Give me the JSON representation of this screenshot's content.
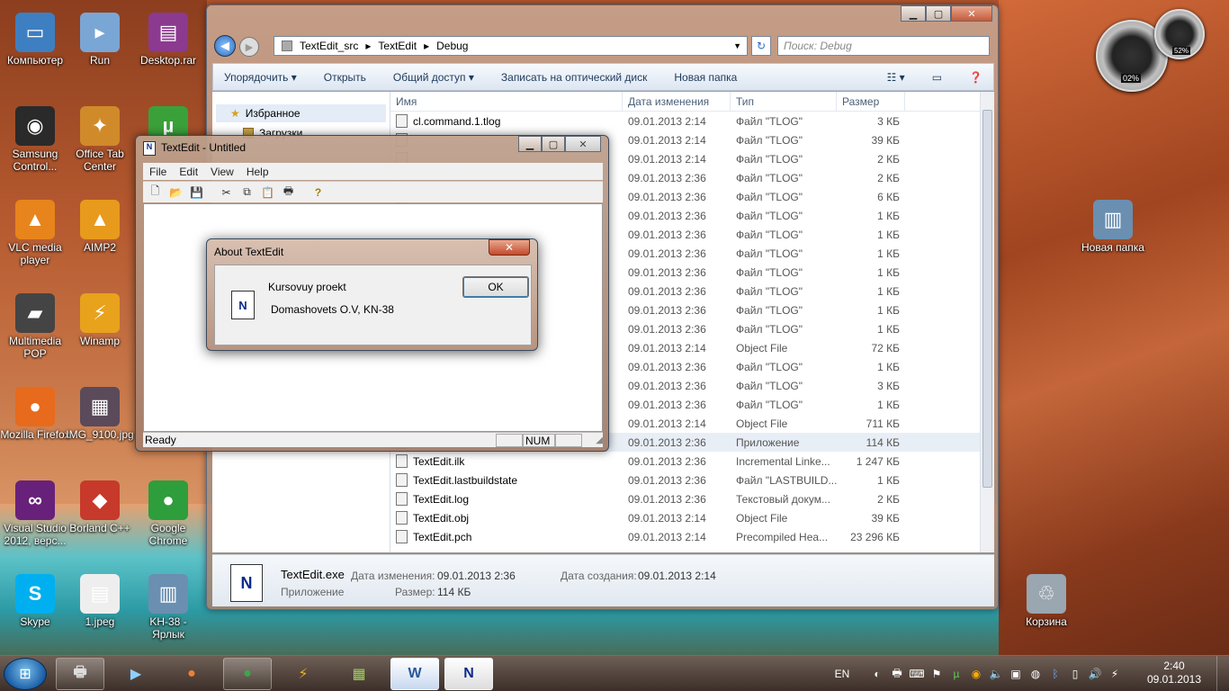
{
  "desktop": {
    "icons": [
      {
        "label": "Компьютер",
        "glyph": "▭",
        "color": "#3d7fc1"
      },
      {
        "label": "Run",
        "glyph": "▸",
        "color": "#7aa6d6"
      },
      {
        "label": "Desktop.rar",
        "glyph": "▤",
        "color": "#8b3a8f"
      },
      {
        "label": "Samsung Control...",
        "glyph": "◉",
        "color": "#2a2a2a"
      },
      {
        "label": "Office Tab Center",
        "glyph": "✦",
        "color": "#d08a2a"
      },
      {
        "label": "µ",
        "glyph": "µ",
        "color": "#3aa13a"
      },
      {
        "label": "VLC media player",
        "glyph": "▲",
        "color": "#e8841c"
      },
      {
        "label": "AIMP2",
        "glyph": "▲",
        "color": "#e89a1c"
      },
      {
        "label": "Multimedia POP",
        "glyph": "▰",
        "color": "#444"
      },
      {
        "label": "Winamp",
        "glyph": "⚡",
        "color": "#e8a21c"
      },
      {
        "label": "Mozilla Firefox",
        "glyph": "●",
        "color": "#e86a1c"
      },
      {
        "label": "IMG_9100.jpg",
        "glyph": "▦",
        "color": "#5a4a5a"
      },
      {
        "label": "Visual Studio 2012, верс...",
        "glyph": "∞",
        "color": "#68217a"
      },
      {
        "label": "Borland C++",
        "glyph": "◆",
        "color": "#c7392a"
      },
      {
        "label": "Google Chrome",
        "glyph": "●",
        "color": "#2e9d3c"
      },
      {
        "label": "Skype",
        "glyph": "S",
        "color": "#00aff0"
      },
      {
        "label": "1.jpeg",
        "glyph": "▤",
        "color": "#eeeeee"
      },
      {
        "label": "KH-38 - Ярлык",
        "glyph": "▥",
        "color": "#6a8fb0"
      },
      {
        "label": "Новая папка",
        "glyph": "▥",
        "color": "#6a8fb0"
      },
      {
        "label": "Корзина",
        "glyph": "♲",
        "color": "#9aa6b0"
      }
    ]
  },
  "gadget": {
    "cpu": "02%",
    "mem": "52%"
  },
  "explorer": {
    "breadcrumb": [
      "TextEdit_src",
      "TextEdit",
      "Debug"
    ],
    "search_placeholder": "Поиск: Debug",
    "toolbar": [
      "Упорядочить ▾",
      "Открыть",
      "Общий доступ ▾",
      "Записать на оптический диск",
      "Новая папка"
    ],
    "nav": {
      "favorites": "Избранное",
      "downloads": "Загрузки"
    },
    "columns": {
      "name": "Имя",
      "date": "Дата изменения",
      "type": "Тип",
      "size": "Размер"
    },
    "files": [
      {
        "name": "cl.command.1.tlog",
        "date": "09.01.2013 2:14",
        "type": "Файл \"TLOG\"",
        "size": "3 КБ"
      },
      {
        "name": "",
        "date": "09.01.2013 2:14",
        "type": "Файл \"TLOG\"",
        "size": "39 КБ"
      },
      {
        "name": "",
        "date": "09.01.2013 2:14",
        "type": "Файл \"TLOG\"",
        "size": "2 КБ"
      },
      {
        "name": "",
        "date": "09.01.2013 2:36",
        "type": "Файл \"TLOG\"",
        "size": "2 КБ"
      },
      {
        "name": "",
        "date": "09.01.2013 2:36",
        "type": "Файл \"TLOG\"",
        "size": "6 КБ"
      },
      {
        "name": "",
        "date": "09.01.2013 2:36",
        "type": "Файл \"TLOG\"",
        "size": "1 КБ"
      },
      {
        "name": "",
        "date": "09.01.2013 2:36",
        "type": "Файл \"TLOG\"",
        "size": "1 КБ"
      },
      {
        "name": "",
        "date": "09.01.2013 2:36",
        "type": "Файл \"TLOG\"",
        "size": "1 КБ"
      },
      {
        "name": "",
        "date": "09.01.2013 2:36",
        "type": "Файл \"TLOG\"",
        "size": "1 КБ"
      },
      {
        "name": "",
        "date": "09.01.2013 2:36",
        "type": "Файл \"TLOG\"",
        "size": "1 КБ"
      },
      {
        "name": "",
        "date": "09.01.2013 2:36",
        "type": "Файл \"TLOG\"",
        "size": "1 КБ"
      },
      {
        "name": "",
        "date": "09.01.2013 2:36",
        "type": "Файл \"TLOG\"",
        "size": "1 КБ"
      },
      {
        "name": "",
        "date": "09.01.2013 2:14",
        "type": "Object File",
        "size": "72 КБ"
      },
      {
        "name": "",
        "date": "09.01.2013 2:36",
        "type": "Файл \"TLOG\"",
        "size": "1 КБ"
      },
      {
        "name": "",
        "date": "09.01.2013 2:36",
        "type": "Файл \"TLOG\"",
        "size": "3 КБ"
      },
      {
        "name": "",
        "date": "09.01.2013 2:36",
        "type": "Файл \"TLOG\"",
        "size": "1 КБ"
      },
      {
        "name": "",
        "date": "09.01.2013 2:14",
        "type": "Object File",
        "size": "711 КБ"
      },
      {
        "name": "",
        "date": "09.01.2013 2:36",
        "type": "Приложение",
        "size": "114 КБ",
        "selected": true
      },
      {
        "name": "TextEdit.ilk",
        "date": "09.01.2013 2:36",
        "type": "Incremental Linke...",
        "size": "1 247 КБ"
      },
      {
        "name": "TextEdit.lastbuildstate",
        "date": "09.01.2013 2:36",
        "type": "Файл \"LASTBUILD...",
        "size": "1 КБ"
      },
      {
        "name": "TextEdit.log",
        "date": "09.01.2013 2:36",
        "type": "Текстовый докум...",
        "size": "2 КБ"
      },
      {
        "name": "TextEdit.obj",
        "date": "09.01.2013 2:14",
        "type": "Object File",
        "size": "39 КБ"
      },
      {
        "name": "TextEdit.pch",
        "date": "09.01.2013 2:14",
        "type": "Precompiled Hea...",
        "size": "23 296 КБ"
      }
    ],
    "details": {
      "filename": "TextEdit.exe",
      "modified_label": "Дата изменения:",
      "modified": "09.01.2013 2:36",
      "created_label": "Дата создания:",
      "created": "09.01.2013 2:14",
      "type": "Приложение",
      "size_label": "Размер:",
      "size": "114 КБ"
    }
  },
  "textedit": {
    "title": "TextEdit - Untitled",
    "menu": [
      "File",
      "Edit",
      "View",
      "Help"
    ],
    "status": {
      "ready": "Ready",
      "num": "NUM"
    }
  },
  "about": {
    "title": "About TextEdit",
    "line1": "Kursovuy proekt",
    "line2": "Domashovets O.V, KN-38",
    "ok": "OK"
  },
  "taskbar": {
    "lang": "EN",
    "time": "2:40",
    "date": "09.01.2013"
  }
}
